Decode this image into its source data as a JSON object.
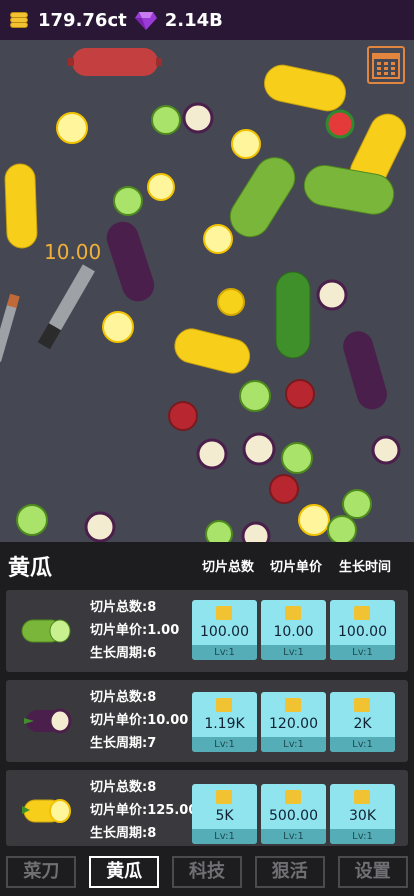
{
  "topbar": {
    "coins": "179.76ct",
    "gems": "2.14B"
  },
  "field": {
    "floating_value": "10.00"
  },
  "panel": {
    "title": "黄瓜",
    "columns": [
      "切片总数",
      "切片单价",
      "生长时间"
    ]
  },
  "cards": [
    {
      "item": "cucumber",
      "stats": [
        "切片总数:8",
        "切片单价:1.00",
        "生长周期:6"
      ],
      "buttons": [
        {
          "value": "100.00",
          "level": "Lv:1"
        },
        {
          "value": "10.00",
          "level": "Lv:1"
        },
        {
          "value": "100.00",
          "level": "Lv:1"
        }
      ]
    },
    {
      "item": "eggplant",
      "stats": [
        "切片总数:8",
        "切片单价:10.00",
        "生长周期:7"
      ],
      "buttons": [
        {
          "value": "1.19K",
          "level": "Lv:1"
        },
        {
          "value": "120.00",
          "level": "Lv:1"
        },
        {
          "value": "2K",
          "level": "Lv:1"
        }
      ]
    },
    {
      "item": "yellow-zucchini",
      "stats": [
        "切片总数:8",
        "切片单价:125.00",
        "生长周期:8"
      ],
      "buttons": [
        {
          "value": "5K",
          "level": "Lv:1"
        },
        {
          "value": "500.00",
          "level": "Lv:1"
        },
        {
          "value": "30K",
          "level": "Lv:1"
        }
      ]
    }
  ],
  "nav": {
    "tabs": [
      "菜刀",
      "黄瓜",
      "科技",
      "狠活",
      "设置"
    ],
    "active_index": 1
  },
  "colors": {
    "accent_button": "#8fe4ee",
    "button_level": "#55aeb7",
    "field_background": "#454752",
    "top_bar": "#2a1736",
    "floating_value": "#f0b03a"
  }
}
